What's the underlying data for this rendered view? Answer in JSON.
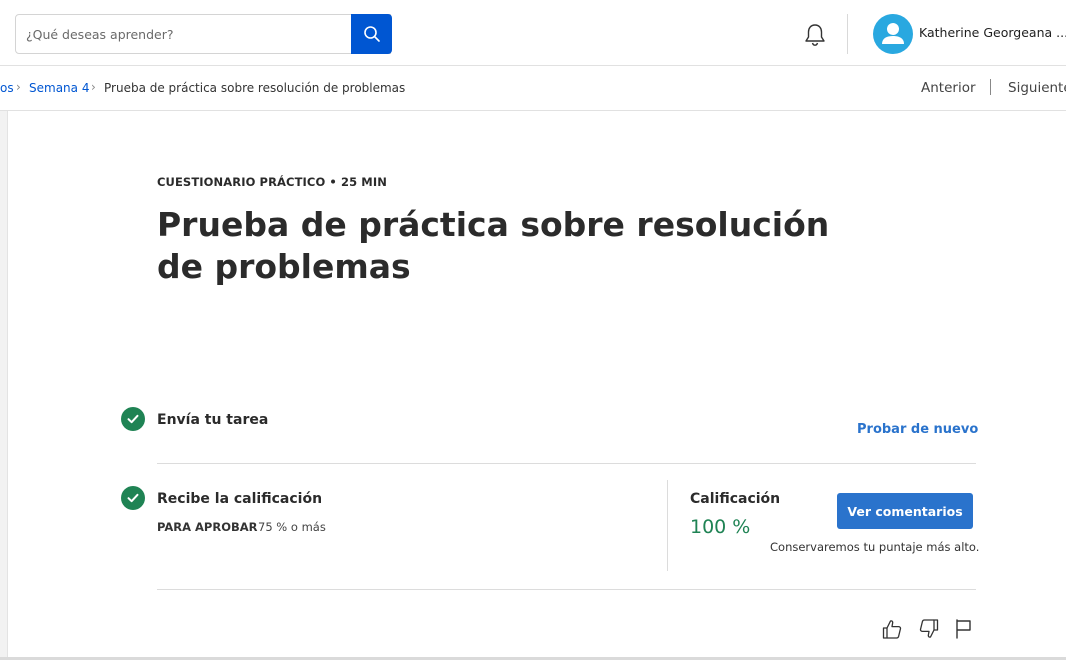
{
  "header": {
    "search": {
      "placeholder": "¿Qué deseas aprender?",
      "button_icon": "search-icon"
    },
    "notifications_icon": "bell-icon",
    "user": {
      "name": "Katherine Georgeana ...",
      "avatar_icon": "user-icon",
      "avatar_color": "#29a8e0"
    }
  },
  "breadcrumb": {
    "items": [
      {
        "label": "os"
      },
      {
        "label": "Semana 4"
      },
      {
        "label": "Prueba de práctica sobre resolución de problemas"
      }
    ],
    "prev_label": "Anterior",
    "next_label": "Siguiente"
  },
  "main": {
    "eyebrow": "CUESTIONARIO PRÁCTICO • 25 MIN",
    "title": "Prueba de práctica sobre resolución de problemas",
    "steps": [
      {
        "title": "Envía tu tarea",
        "status": "complete",
        "action_label": "Probar de nuevo"
      },
      {
        "title": "Recibe la calificación",
        "status": "complete",
        "pass_label": "PARA APROBAR",
        "pass_value": "75 % o más"
      }
    ],
    "grade": {
      "label": "Calificación",
      "value": "100 %",
      "button_label": "Ver comentarios",
      "note": "Conservaremos tu puntaje más alto."
    },
    "feedback_icons": [
      "thumbs-up-icon",
      "thumbs-down-icon",
      "flag-icon"
    ]
  },
  "colors": {
    "primary_blue": "#0056d2",
    "button_blue": "#2a73cc",
    "success_green": "#1f8354"
  }
}
